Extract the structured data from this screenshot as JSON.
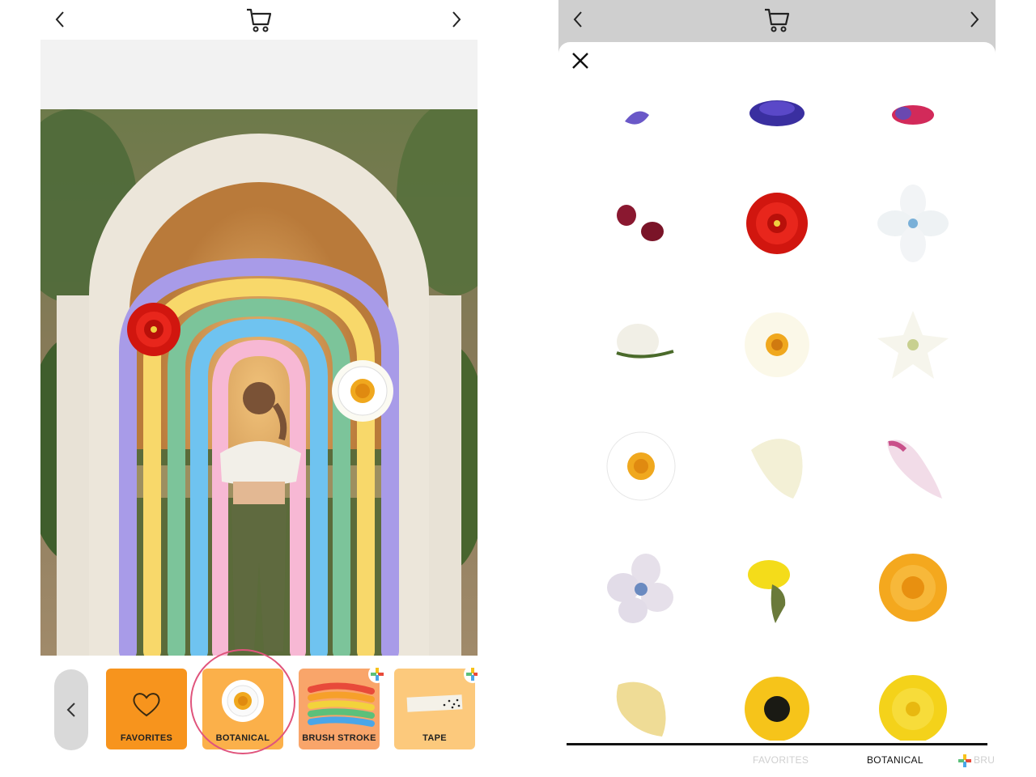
{
  "left_panel": {
    "categories": [
      {
        "label": "FAVORITES",
        "color": "#f7941d",
        "icon": "heart-icon"
      },
      {
        "label": "BOTANICAL",
        "color": "#fbb04a",
        "icon": "daisy-icon",
        "selected": true
      },
      {
        "label": "BRUSH STROKE",
        "color": "#f9a56a",
        "icon": "brush-stroke-icon",
        "has_plus": true
      },
      {
        "label": "TAPE",
        "color": "#fcc97c",
        "icon": "tape-icon",
        "has_plus": true
      }
    ]
  },
  "right_panel": {
    "tabs": [
      {
        "label": "FAVORITES",
        "state": "inactive"
      },
      {
        "label": "BOTANICAL",
        "state": "active"
      },
      {
        "label": "BRUS",
        "state": "partial"
      }
    ],
    "stickers": [
      "purple-petal",
      "blue-violet-flower",
      "pink-flower",
      "dark-red-petals",
      "red-rose",
      "white-blue-hydrangea",
      "white-clover",
      "white-daisy-large",
      "white-star-flower",
      "white-daisy",
      "cream-petal",
      "pink-petal",
      "pale-blue-hydrangea",
      "yellow-marigold-bud",
      "orange-chrysanthemum",
      "yellow-petal",
      "black-eyed-susan",
      "yellow-buttercup"
    ]
  },
  "colors": {
    "accent_ring": "#e0547c",
    "rainbow": [
      "#a89be8",
      "#f8d86a",
      "#7cc49a",
      "#6fc3f0",
      "#f7b8d4"
    ]
  }
}
